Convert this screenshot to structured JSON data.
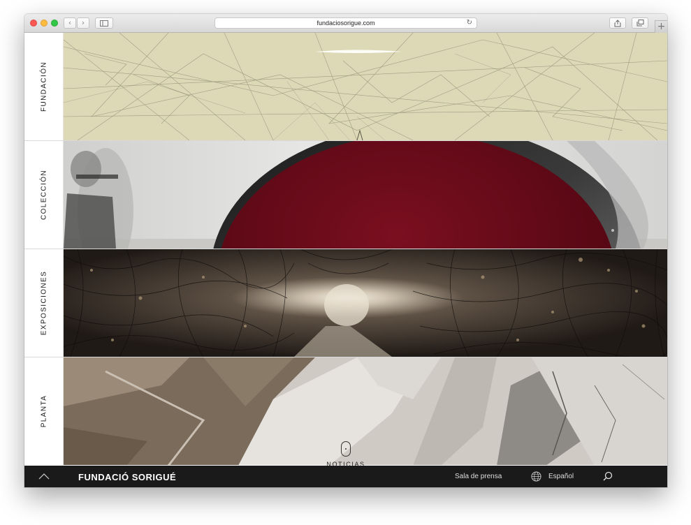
{
  "browser": {
    "url": "fundaciosorigue.com",
    "back_glyph": "‹",
    "forward_glyph": "›",
    "reload_glyph": "↻",
    "new_tab_glyph": "+",
    "icons": [
      "traffic-lights",
      "back-icon",
      "forward-icon",
      "sidebar-icon",
      "reload-icon",
      "share-icon",
      "tabs-icon",
      "new-tab-icon"
    ]
  },
  "sections": [
    {
      "label": "FUNDACIÓN"
    },
    {
      "label": "COLECCIÓN"
    },
    {
      "label": "EXPOSICIONES"
    },
    {
      "label": "PLANTA"
    }
  ],
  "scroll_hint": {
    "label": "NOTICIAS",
    "icon": "mouse-icon"
  },
  "footer": {
    "brand": "FUNDACIÓ SORIGUÉ",
    "press": "Sala de prensa",
    "language": "Español",
    "icons": [
      "chevron-up-icon",
      "globe-icon",
      "search-icon"
    ]
  },
  "colors": {
    "footer_bg": "#1a1a1a",
    "toolbar_bg": "#e0e0e0",
    "coleccion_red": "#6b0a18"
  }
}
